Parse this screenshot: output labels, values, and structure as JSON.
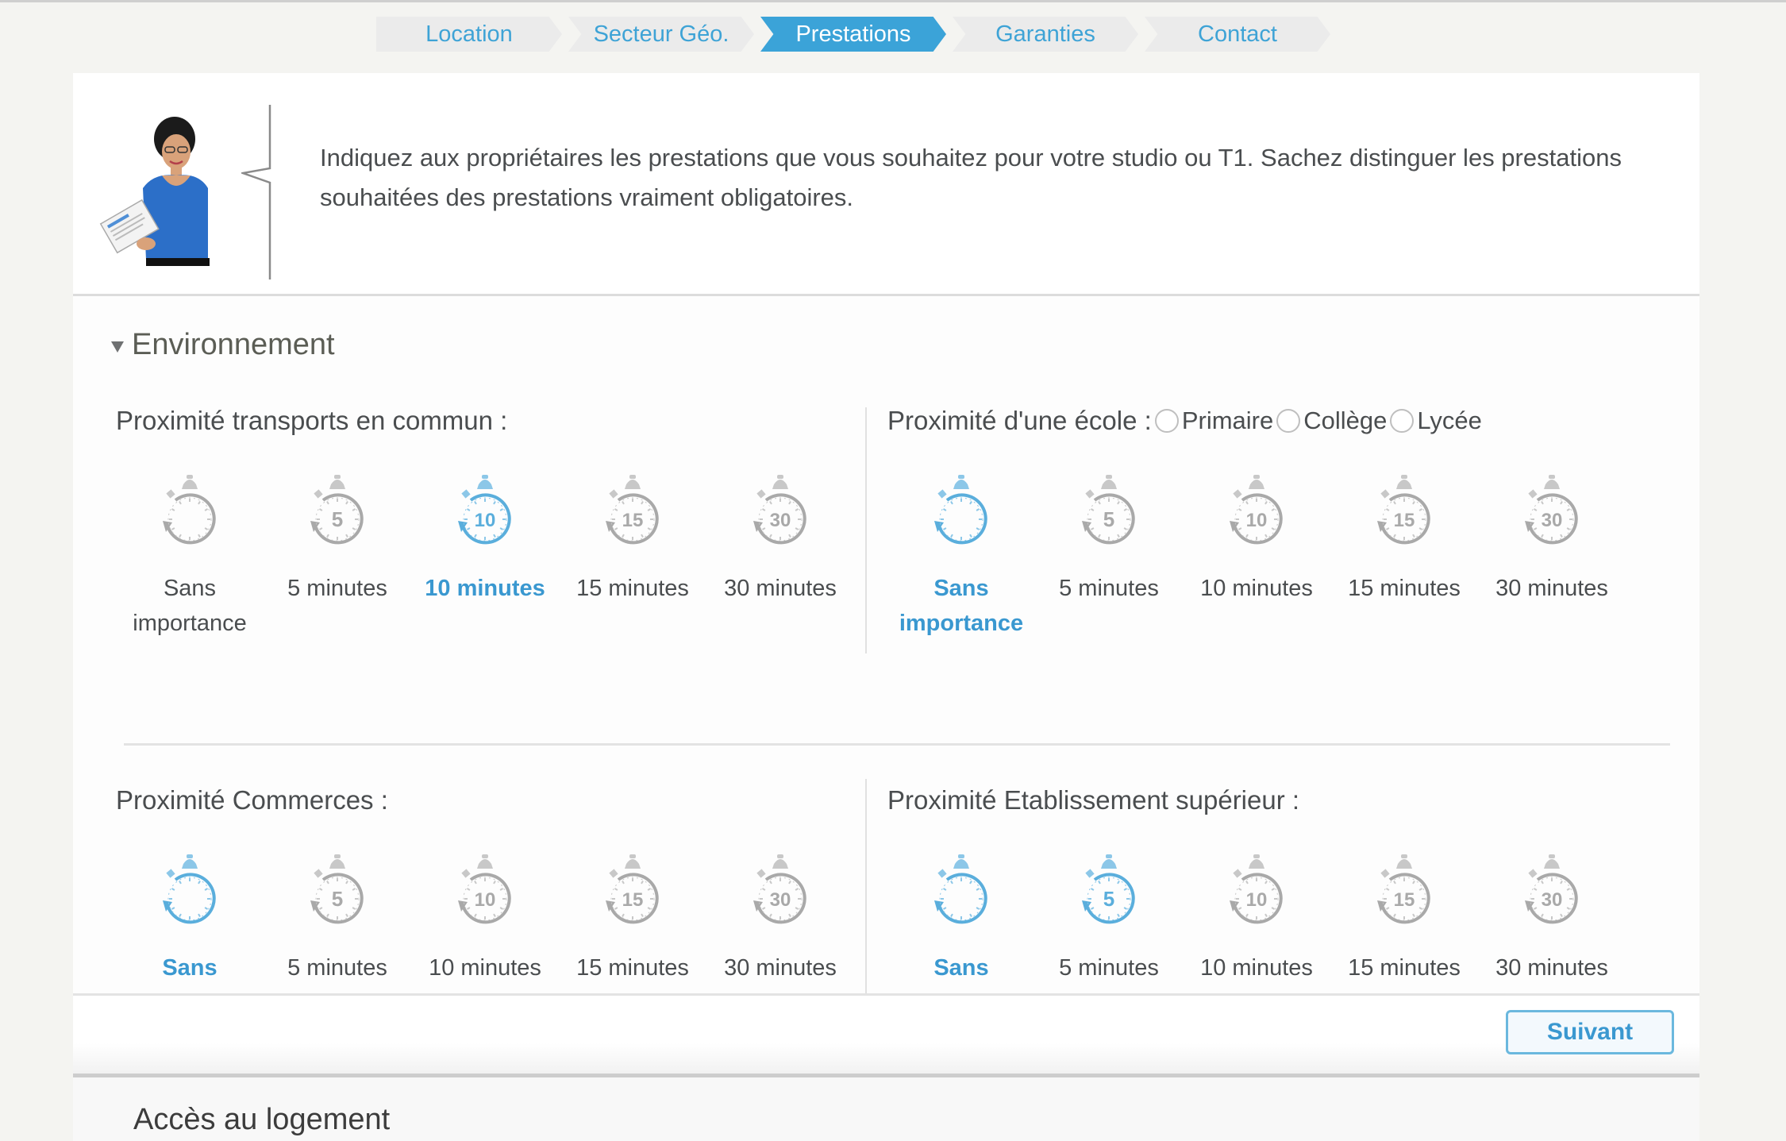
{
  "stepper": {
    "steps": [
      {
        "label": "Location",
        "active": false
      },
      {
        "label": "Secteur Géo.",
        "active": false
      },
      {
        "label": "Prestations",
        "active": true
      },
      {
        "label": "Garanties",
        "active": false
      },
      {
        "label": "Contact",
        "active": false
      }
    ]
  },
  "intro": {
    "avatar_icon": "assistant-avatar",
    "text": "Indiquez aux propriétaires les prestations que vous souhaitez pour votre studio ou T1. Sachez distinguer les prestations souhaitées des prestations vraiment obligatoires."
  },
  "section": {
    "title": "Environnement",
    "expanded": true,
    "groups": [
      {
        "title": "Proximité transports en commun :",
        "selected_label_index": 2,
        "highlighted_icons": [
          2
        ],
        "options": [
          {
            "icon_number": "",
            "label": "Sans importance"
          },
          {
            "icon_number": "5",
            "label": "5 minutes"
          },
          {
            "icon_number": "10",
            "label": "10 minutes"
          },
          {
            "icon_number": "15",
            "label": "15 minutes"
          },
          {
            "icon_number": "30",
            "label": "30 minutes"
          }
        ]
      },
      {
        "title": "Proximité d'une école :",
        "radios": [
          {
            "label": "Primaire",
            "checked": false
          },
          {
            "label": "Collège",
            "checked": false
          },
          {
            "label": "Lycée",
            "checked": false
          }
        ],
        "selected_label_index": 0,
        "highlighted_icons": [
          0
        ],
        "options": [
          {
            "icon_number": "",
            "label": "Sans importance"
          },
          {
            "icon_number": "5",
            "label": "5 minutes"
          },
          {
            "icon_number": "10",
            "label": "10 minutes"
          },
          {
            "icon_number": "15",
            "label": "15 minutes"
          },
          {
            "icon_number": "30",
            "label": "30 minutes"
          }
        ]
      },
      {
        "title": "Proximité Commerces :",
        "selected_label_index": 0,
        "highlighted_icons": [
          0
        ],
        "options": [
          {
            "icon_number": "",
            "label": "Sans importance"
          },
          {
            "icon_number": "5",
            "label": "5 minutes"
          },
          {
            "icon_number": "10",
            "label": "10 minutes"
          },
          {
            "icon_number": "15",
            "label": "15 minutes"
          },
          {
            "icon_number": "30",
            "label": "30 minutes"
          }
        ]
      },
      {
        "title": "Proximité Etablissement supérieur :",
        "selected_label_index": 0,
        "highlighted_icons": [
          0,
          1
        ],
        "options": [
          {
            "icon_number": "",
            "label": "Sans importance"
          },
          {
            "icon_number": "5",
            "label": "5 minutes"
          },
          {
            "icon_number": "10",
            "label": "10 minutes"
          },
          {
            "icon_number": "15",
            "label": "15 minutes"
          },
          {
            "icon_number": "30",
            "label": "30 minutes"
          }
        ]
      }
    ]
  },
  "footer": {
    "next_label": "Suivant"
  },
  "next_section": {
    "title": "Accès au logement"
  },
  "colors": {
    "accent": "#3ba3d8",
    "selected_text": "#3a98d0",
    "icon_inactive": "#a9a9a9",
    "icon_active": "#5aaedc",
    "background": "#f4f4f1"
  }
}
